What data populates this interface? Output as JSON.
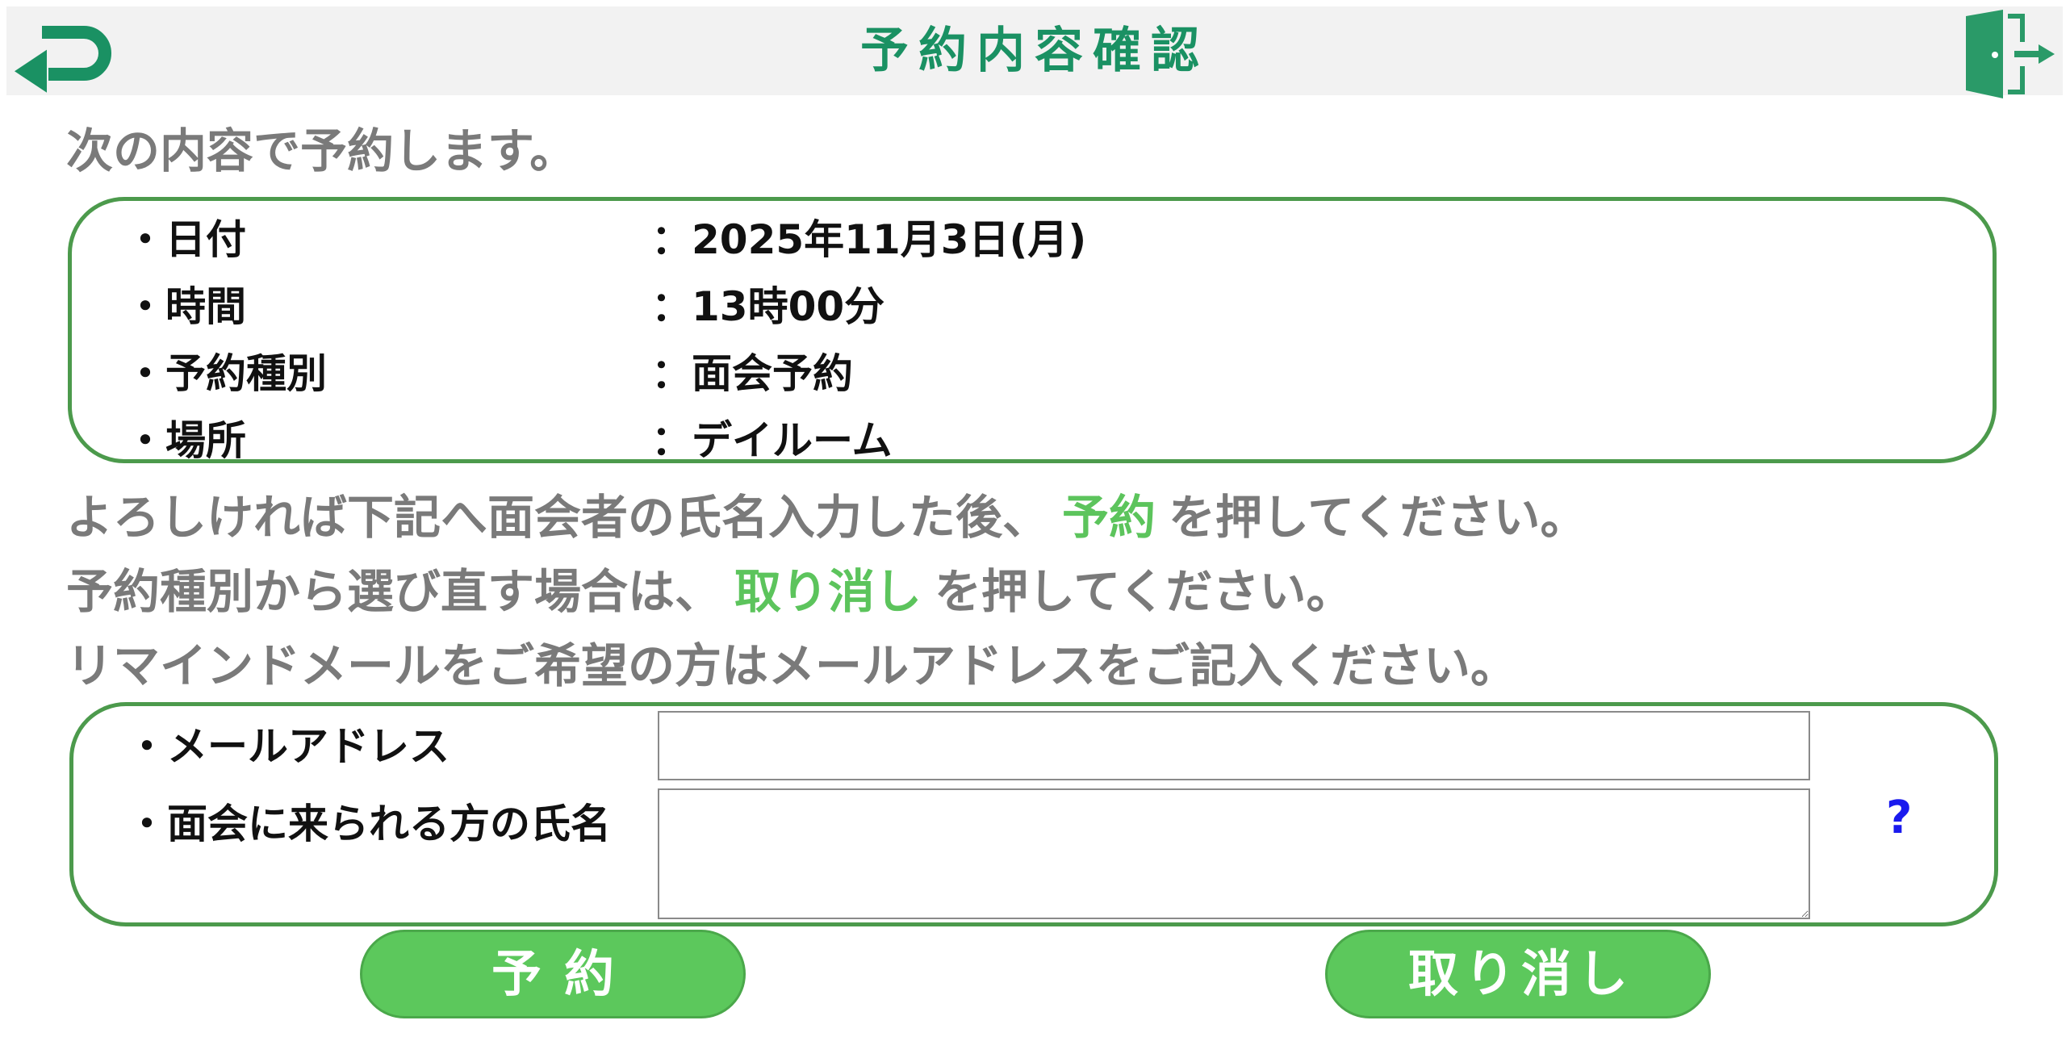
{
  "header": {
    "title": "予約内容確認",
    "back_icon": "back-arrow-icon",
    "exit_icon": "exit-door-icon",
    "accent_color": "#1a9163"
  },
  "intro": "次の内容で予約します。",
  "details": [
    {
      "label": "・日付",
      "value": "：2025年11月3日(月)"
    },
    {
      "label": "・時間",
      "value": "：13時00分"
    },
    {
      "label": "・予約種別",
      "value": "：面会予約"
    },
    {
      "label": "・場所",
      "value": "：デイルーム"
    }
  ],
  "messages": {
    "line1_prefix": "よろしければ下記へ面会者の氏名入力した後、",
    "line1_keyword": "予約",
    "line1_suffix": "を押してください。",
    "line2_prefix": "予約種別から選び直す場合は、",
    "line2_keyword": "取り消し",
    "line2_suffix": "を押してください。",
    "line3": "リマインドメールをご希望の方はメールアドレスをご記入ください。"
  },
  "form": {
    "email_label": "・メールアドレス",
    "email_value": "",
    "email_placeholder": "",
    "name_label": "・面会に来られる方の氏名",
    "name_value": "",
    "name_placeholder": "",
    "help_text": "?"
  },
  "buttons": {
    "reserve": "予約",
    "cancel": "取り消し",
    "color": "#5cc85c"
  }
}
